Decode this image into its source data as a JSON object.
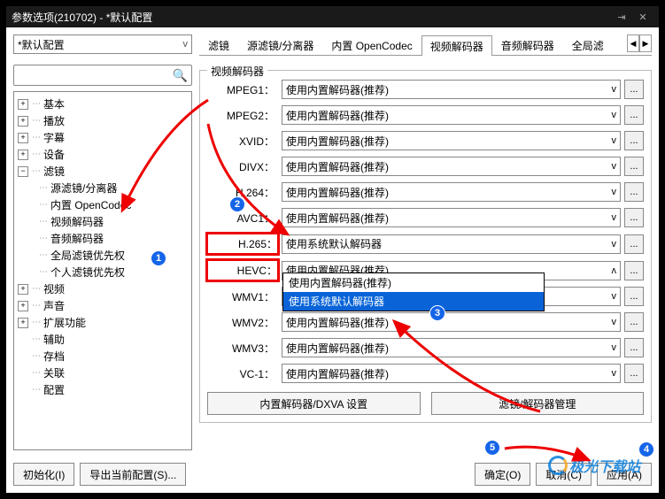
{
  "window": {
    "title": "参数选项(210702) - *默认配置"
  },
  "profile": {
    "selected": "*默认配置"
  },
  "tabs": {
    "items": [
      "滤镜",
      "源滤镜/分离器",
      "内置 OpenCodec",
      "视频解码器",
      "音频解码器",
      "全局滤"
    ],
    "active_index": 3
  },
  "tree": {
    "items": [
      {
        "label": "基本",
        "exp": false
      },
      {
        "label": "播放",
        "exp": false
      },
      {
        "label": "字幕",
        "exp": false
      },
      {
        "label": "设备",
        "exp": false
      },
      {
        "label": "滤镜",
        "exp": true,
        "children": [
          {
            "label": "源滤镜/分离器"
          },
          {
            "label": "内置 OpenCodec"
          },
          {
            "label": "视频解码器"
          },
          {
            "label": "音频解码器"
          },
          {
            "label": "全局滤镜优先权"
          },
          {
            "label": "个人滤镜优先权"
          }
        ]
      },
      {
        "label": "视频",
        "exp": false
      },
      {
        "label": "声音",
        "exp": false
      },
      {
        "label": "扩展功能",
        "exp": false
      },
      {
        "label": "辅助",
        "exp": null
      },
      {
        "label": "存档",
        "exp": null
      },
      {
        "label": "关联",
        "exp": null
      },
      {
        "label": "配置",
        "exp": null
      }
    ]
  },
  "group": {
    "title": "视频解码器"
  },
  "codecs": [
    {
      "label": "MPEG1：",
      "value": "使用内置解码器(推荐)",
      "caret": "v"
    },
    {
      "label": "MPEG2：",
      "value": "使用内置解码器(推荐)",
      "caret": "v"
    },
    {
      "label": "XVID：",
      "value": "使用内置解码器(推荐)",
      "caret": "v"
    },
    {
      "label": "DIVX：",
      "value": "使用内置解码器(推荐)",
      "caret": "v"
    },
    {
      "label": "H.264：",
      "value": "使用内置解码器(推荐)",
      "caret": "v"
    },
    {
      "label": "AVC1：",
      "value": "使用内置解码器(推荐)",
      "caret": "v"
    },
    {
      "label": "H.265：",
      "value": "使用系统默认解码器",
      "caret": "v",
      "red": true
    },
    {
      "label": "HEVC：",
      "value": "使用内置解码器(推荐)",
      "caret": "ʌ",
      "red": true,
      "open": true
    },
    {
      "label": "WMV1：",
      "value": "使用内置解码器(推荐)",
      "caret": "v"
    },
    {
      "label": "WMV2：",
      "value": "使用内置解码器(推荐)",
      "caret": "v"
    },
    {
      "label": "WMV3：",
      "value": "使用内置解码器(推荐)",
      "caret": "v"
    },
    {
      "label": "VC-1：",
      "value": "使用内置解码器(推荐)",
      "caret": "v"
    }
  ],
  "dropdown": {
    "options": [
      "使用内置解码器(推荐)",
      "使用系统默认解码器"
    ],
    "highlight_index": 1
  },
  "buttons": {
    "dxva": "内置解码器/DXVA 设置",
    "filter_mgr": "滤镜/解码器管理",
    "init": "初始化(I)",
    "export": "导出当前配置(S)...",
    "ok": "确定(O)",
    "cancel": "取消(C)",
    "apply": "应用(A)"
  },
  "watermark": "极光下载站"
}
